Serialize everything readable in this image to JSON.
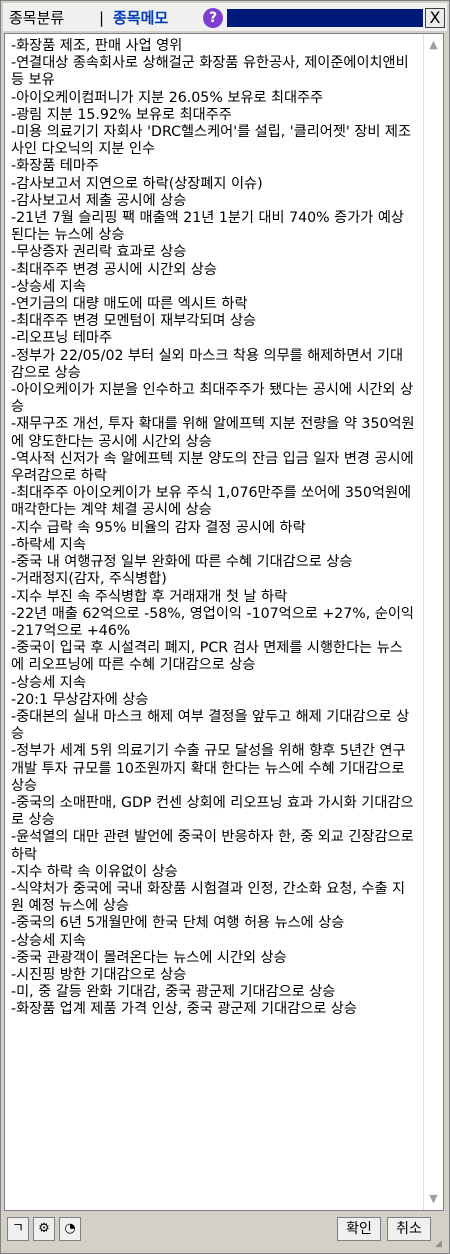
{
  "header": {
    "tab_classify": "종목분류",
    "separator": "|",
    "tab_memo": "종목메모",
    "help_glyph": "?",
    "close_glyph": "X"
  },
  "memo": {
    "text": "-화장품 제조, 판매 사업 영위\n-연결대상 종속회사로 상해걸군 화장품 유한공사, 제이준에이치앤비 등 보유\n-아이오케이컴퍼니가 지분 26.05% 보유로 최대주주\n-광림 지분 15.92% 보유로 최대주주\n-미용 의료기기 자회사 'DRC헬스케어'를 설립, '클리어젯' 장비 제조사인 다오닉의 지분 인수\n-화장품 테마주\n-감사보고서 지연으로 하락(상장폐지 이슈)\n-감사보고서 제출 공시에 상승\n-21년 7월 슬리핑 팩 매출액 21년 1분기 대비 740% 증가가 예상된다는 뉴스에 상승\n-무상증자 권리락 효과로 상승\n-최대주주 변경 공시에 시간외 상승\n-상승세 지속\n-연기금의 대량 매도에 따른 엑시트 하락\n-최대주주 변경 모멘텀이 재부각되며 상승\n-리오프닝 테마주\n-정부가 22/05/02 부터 실외 마스크 착용 의무를 해제하면서 기대감으로 상승\n-아이오케이가 지분을 인수하고 최대주주가 됐다는 공시에 시간외 상승\n-재무구조 개선, 투자 확대를 위해 알에프텍 지분 전량을 약 350억원에 양도한다는 공시에 시간외 상승\n-역사적 신저가 속 알에프텍 지분 양도의 잔금 입금 일자 변경 공시에 우려감으로 하락\n-최대주주 아이오케이가 보유 주식 1,076만주를 쏘어에 350억원에 매각한다는 계약 체결 공시에 상승\n-지수 급락 속 95% 비율의 감자 결정 공시에 하락\n-하락세 지속\n-중국 내 여행규정 일부 완화에 따른 수혜 기대감으로 상승\n-거래정지(감자, 주식병합)\n-지수 부진 속 주식병합 후 거래재개 첫 날 하락\n-22년 매출 62억으로 -58%, 영업이익 -107억으로 +27%, 순이익 -217억으로 +46%\n-중국이 입국 후 시설격리 폐지, PCR 검사 면제를 시행한다는 뉴스에 리오프닝에 따른 수혜 기대감으로 상승\n-상승세 지속\n-20:1 무상감자에 상승\n-중대본의 실내 마스크 해제 여부 결정을 앞두고 해제 기대감으로 상승\n-정부가 세계 5위 의료기기 수출 규모 달성을 위해 향후 5년간 연구개발 투자 규모를 10조원까지 확대 한다는 뉴스에 수혜 기대감으로 상승\n-중국의 소매판매, GDP 컨센 상회에 리오프닝 효과 가시화 기대감으로 상승\n-윤석열의 대만 관련 발언에 중국이 반응하자 한, 중 외교 긴장감으로 하락\n-지수 하락 속 이유없이 상승\n-식약처가 중국에 국내 화장품 시험결과 인정, 간소화 요청, 수출 지원 예정 뉴스에 상승\n-중국의 6년 5개월만에 한국 단체 여행 허용 뉴스에 상승\n-상승세 지속\n-중국 관광객이 몰려온다는 뉴스에 시간외 상승\n-시진핑 방한 기대감으로 상승\n-미, 중 갈등 완화 기대감, 중국 광군제 기대감으로 상승\n-화장품 업계 제품 가격 인상, 중국 광군제 기대감으로 상승"
  },
  "scrollbar": {
    "up_glyph": "▲",
    "down_glyph": "▼"
  },
  "footer": {
    "icon1_glyph": "ㄱ",
    "icon2_glyph": "⚙",
    "icon3_glyph": "◔",
    "ok_label": "확인",
    "cancel_label": "취소"
  },
  "colors": {
    "memo_tab": "#003cb4",
    "help_badge": "#7e3fd0",
    "title_highlight": "#001a7a"
  }
}
